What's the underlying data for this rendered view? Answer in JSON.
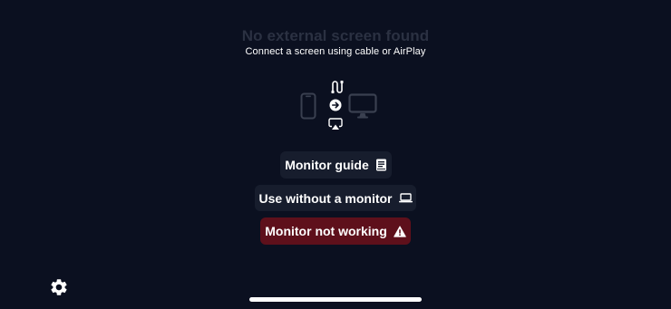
{
  "status": {
    "title": "No external screen found",
    "subtitle": "Connect a screen using cable or AirPlay"
  },
  "illustration": {
    "icons": [
      "phone-icon",
      "cable-icon",
      "arrow-right-circle-icon",
      "airplay-icon",
      "monitor-icon"
    ]
  },
  "actions": {
    "guide_label": "Monitor guide",
    "guide_icon": "book-icon",
    "no_monitor_label": "Use without a monitor",
    "no_monitor_icon": "laptop-icon",
    "not_working_label": "Monitor not working",
    "not_working_icon": "warning-icon"
  },
  "toolbar": {
    "settings_icon": "gear-icon"
  },
  "colors": {
    "background": "#0b1020",
    "button": "#171d2d",
    "danger_button": "#5e101b",
    "muted_title": "#2b3142",
    "illustration_gray": "#3a4050"
  }
}
